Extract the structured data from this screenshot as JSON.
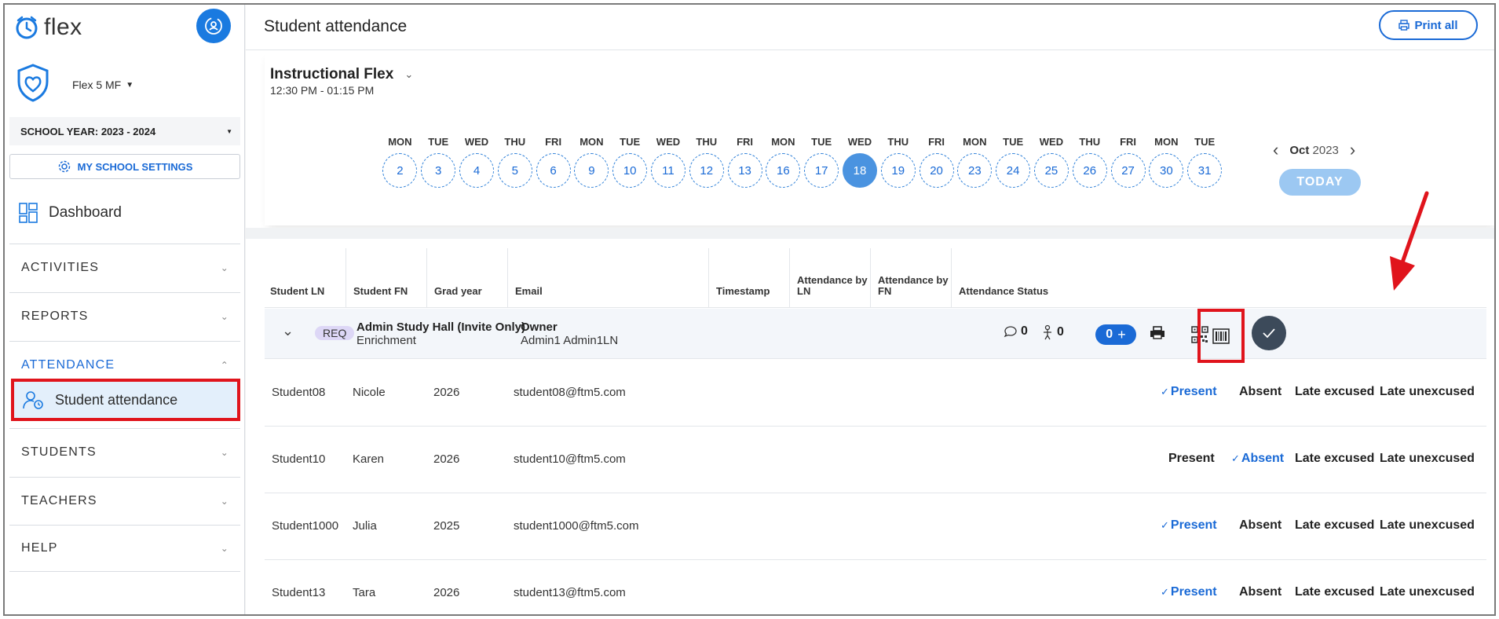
{
  "app": {
    "logo_text": "flex"
  },
  "sidebar": {
    "school": "Flex 5 MF",
    "school_year": "SCHOOL YEAR: 2023 - 2024",
    "settings_label": "MY SCHOOL SETTINGS",
    "dashboard_label": "Dashboard",
    "sections": [
      "ACTIVITIES",
      "REPORTS",
      "ATTENDANCE",
      "STUDENTS",
      "TEACHERS",
      "HELP"
    ],
    "active_item": "Student attendance"
  },
  "header": {
    "title": "Student attendance",
    "print_all": "Print all"
  },
  "flex": {
    "name": "Instructional Flex",
    "time": "12:30 PM - 01:15 PM",
    "month": "Oct",
    "year": "2023",
    "today_label": "TODAY",
    "days": [
      {
        "dow": "MON",
        "d": "2"
      },
      {
        "dow": "TUE",
        "d": "3"
      },
      {
        "dow": "WED",
        "d": "4"
      },
      {
        "dow": "THU",
        "d": "5"
      },
      {
        "dow": "FRI",
        "d": "6"
      },
      {
        "dow": "MON",
        "d": "9"
      },
      {
        "dow": "TUE",
        "d": "10"
      },
      {
        "dow": "WED",
        "d": "11"
      },
      {
        "dow": "THU",
        "d": "12"
      },
      {
        "dow": "FRI",
        "d": "13"
      },
      {
        "dow": "MON",
        "d": "16"
      },
      {
        "dow": "TUE",
        "d": "17"
      },
      {
        "dow": "WED",
        "d": "18"
      },
      {
        "dow": "THU",
        "d": "19"
      },
      {
        "dow": "FRI",
        "d": "20"
      },
      {
        "dow": "MON",
        "d": "23"
      },
      {
        "dow": "TUE",
        "d": "24"
      },
      {
        "dow": "WED",
        "d": "25"
      },
      {
        "dow": "THU",
        "d": "26"
      },
      {
        "dow": "FRI",
        "d": "27"
      },
      {
        "dow": "MON",
        "d": "30"
      },
      {
        "dow": "TUE",
        "d": "31"
      }
    ],
    "selected_day": "18"
  },
  "table": {
    "headers": [
      "Student LN",
      "Student FN",
      "Grad year",
      "Email",
      "Timestamp",
      "Attendance by LN",
      "Attendance by FN",
      "Attendance Status"
    ],
    "group": {
      "badge": "REQ",
      "activity": "Admin Study Hall (Invite Only)",
      "type": "Enrichment",
      "owner_label": "Owner",
      "owner": "Admin1 Admin1LN",
      "comments": "0",
      "people": "0",
      "count": "0"
    },
    "status_options": [
      "Present",
      "Absent",
      "Late excused",
      "Late unexcused"
    ],
    "rows": [
      {
        "ln": "Student08",
        "fn": "Nicole",
        "grad": "2026",
        "email": "student08@ftm5.com",
        "status": "Present"
      },
      {
        "ln": "Student10",
        "fn": "Karen",
        "grad": "2026",
        "email": "student10@ftm5.com",
        "status": "Absent"
      },
      {
        "ln": "Student1000",
        "fn": "Julia",
        "grad": "2025",
        "email": "student1000@ftm5.com",
        "status": "Present"
      },
      {
        "ln": "Student13",
        "fn": "Tara",
        "grad": "2026",
        "email": "student13@ftm5.com",
        "status": "Present"
      }
    ]
  },
  "colors": {
    "accent": "#1a6ad6",
    "highlight": "#e0141c",
    "active_bg": "#e3effb"
  }
}
